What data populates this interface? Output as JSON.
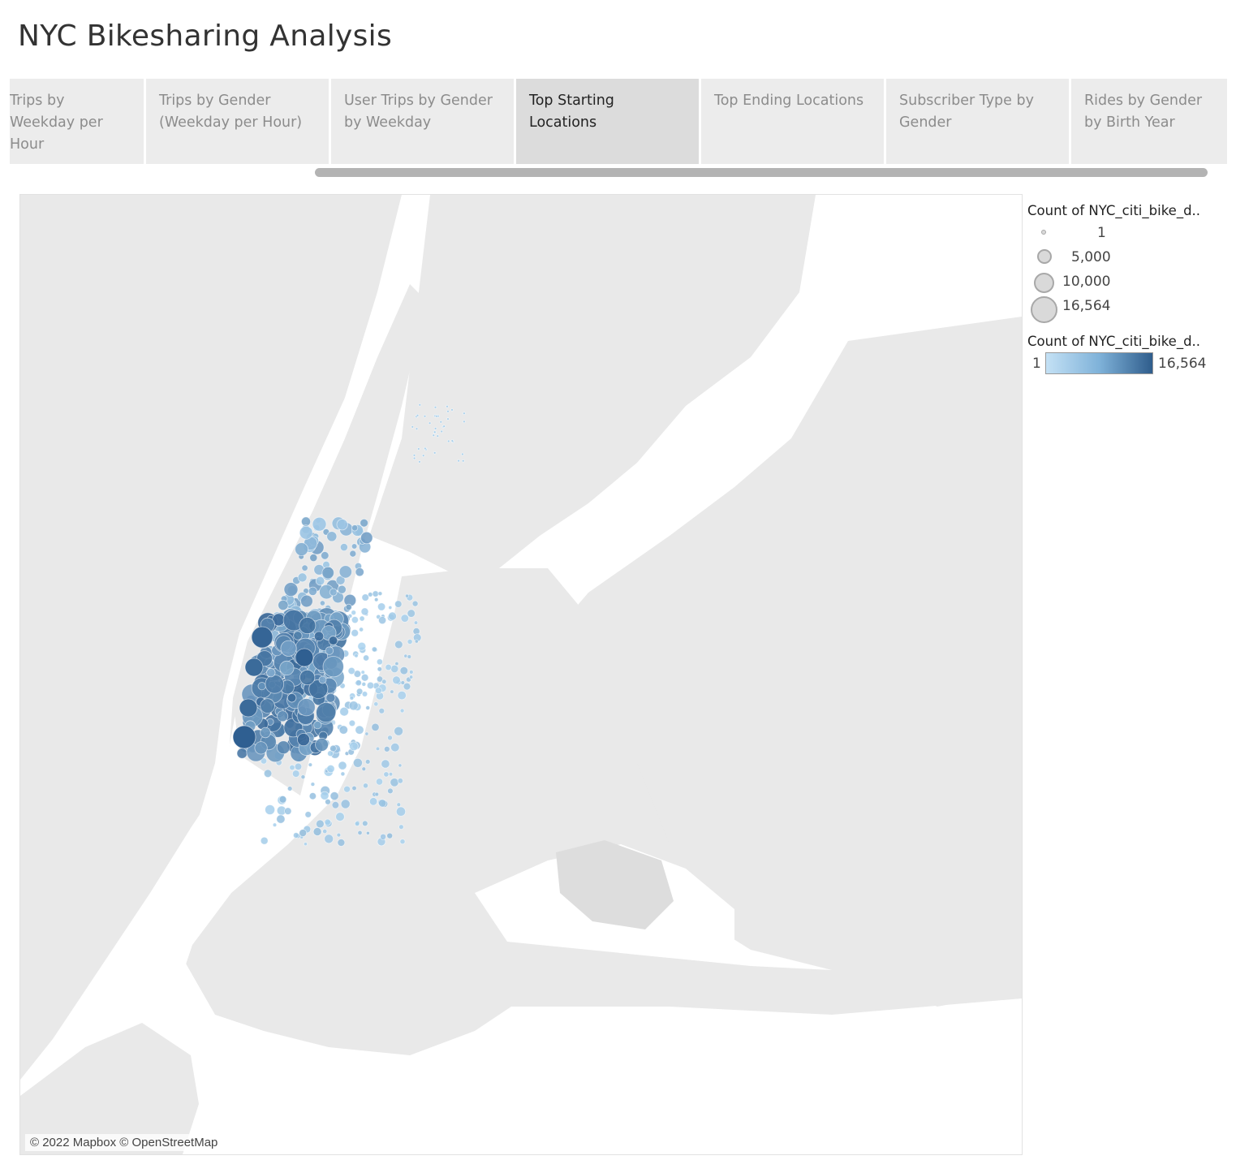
{
  "app": {
    "title": "NYC Bikesharing Analysis"
  },
  "tabs": [
    {
      "label": "Trips by Weekday per Hour",
      "active": false
    },
    {
      "label": "Trips by Gender (Weekday per Hour)",
      "active": false
    },
    {
      "label": "User Trips by Gender by Weekday",
      "active": false
    },
    {
      "label": "Top Starting Locations",
      "active": true
    },
    {
      "label": "Top Ending Locations",
      "active": false
    },
    {
      "label": "Subscriber Type by Gender",
      "active": false
    },
    {
      "label": "Rides by Gender by Birth Year",
      "active": false
    }
  ],
  "map": {
    "attribution": "© 2022 Mapbox © OpenStreetMap",
    "colors": {
      "land": "#e9e9e9",
      "water": "#ffffff",
      "low": "#a9d2ee",
      "high": "#2f5f91"
    }
  },
  "legend": {
    "size_title": "Count of NYC_citi_bike_d..",
    "size_items": [
      "1",
      "5,000",
      "10,000",
      "16,564"
    ],
    "color_title": "Count of NYC_citi_bike_d..",
    "color_min": "1",
    "color_max": "16,564"
  }
}
